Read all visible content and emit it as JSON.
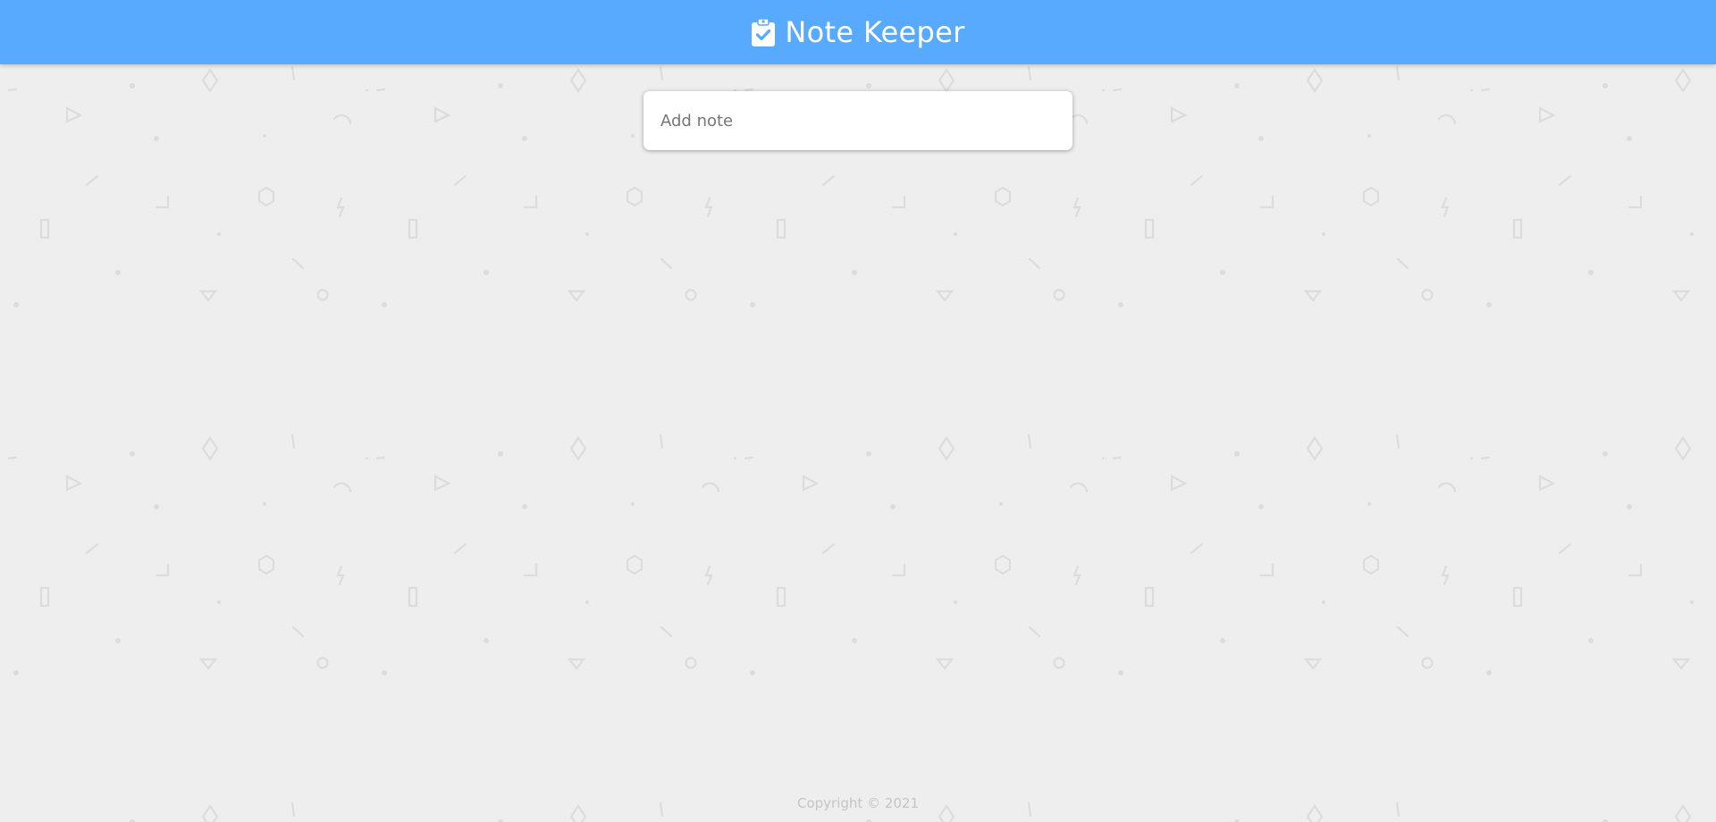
{
  "header": {
    "title": "Note Keeper",
    "icon": "clipboard-check-icon",
    "background_color": "#58aafe"
  },
  "note_form": {
    "placeholder": "Add note",
    "value": ""
  },
  "footer": {
    "copyright": "Copyright © 2021"
  },
  "background": {
    "color": "#eeeeee",
    "pattern": "doodle-shapes"
  }
}
